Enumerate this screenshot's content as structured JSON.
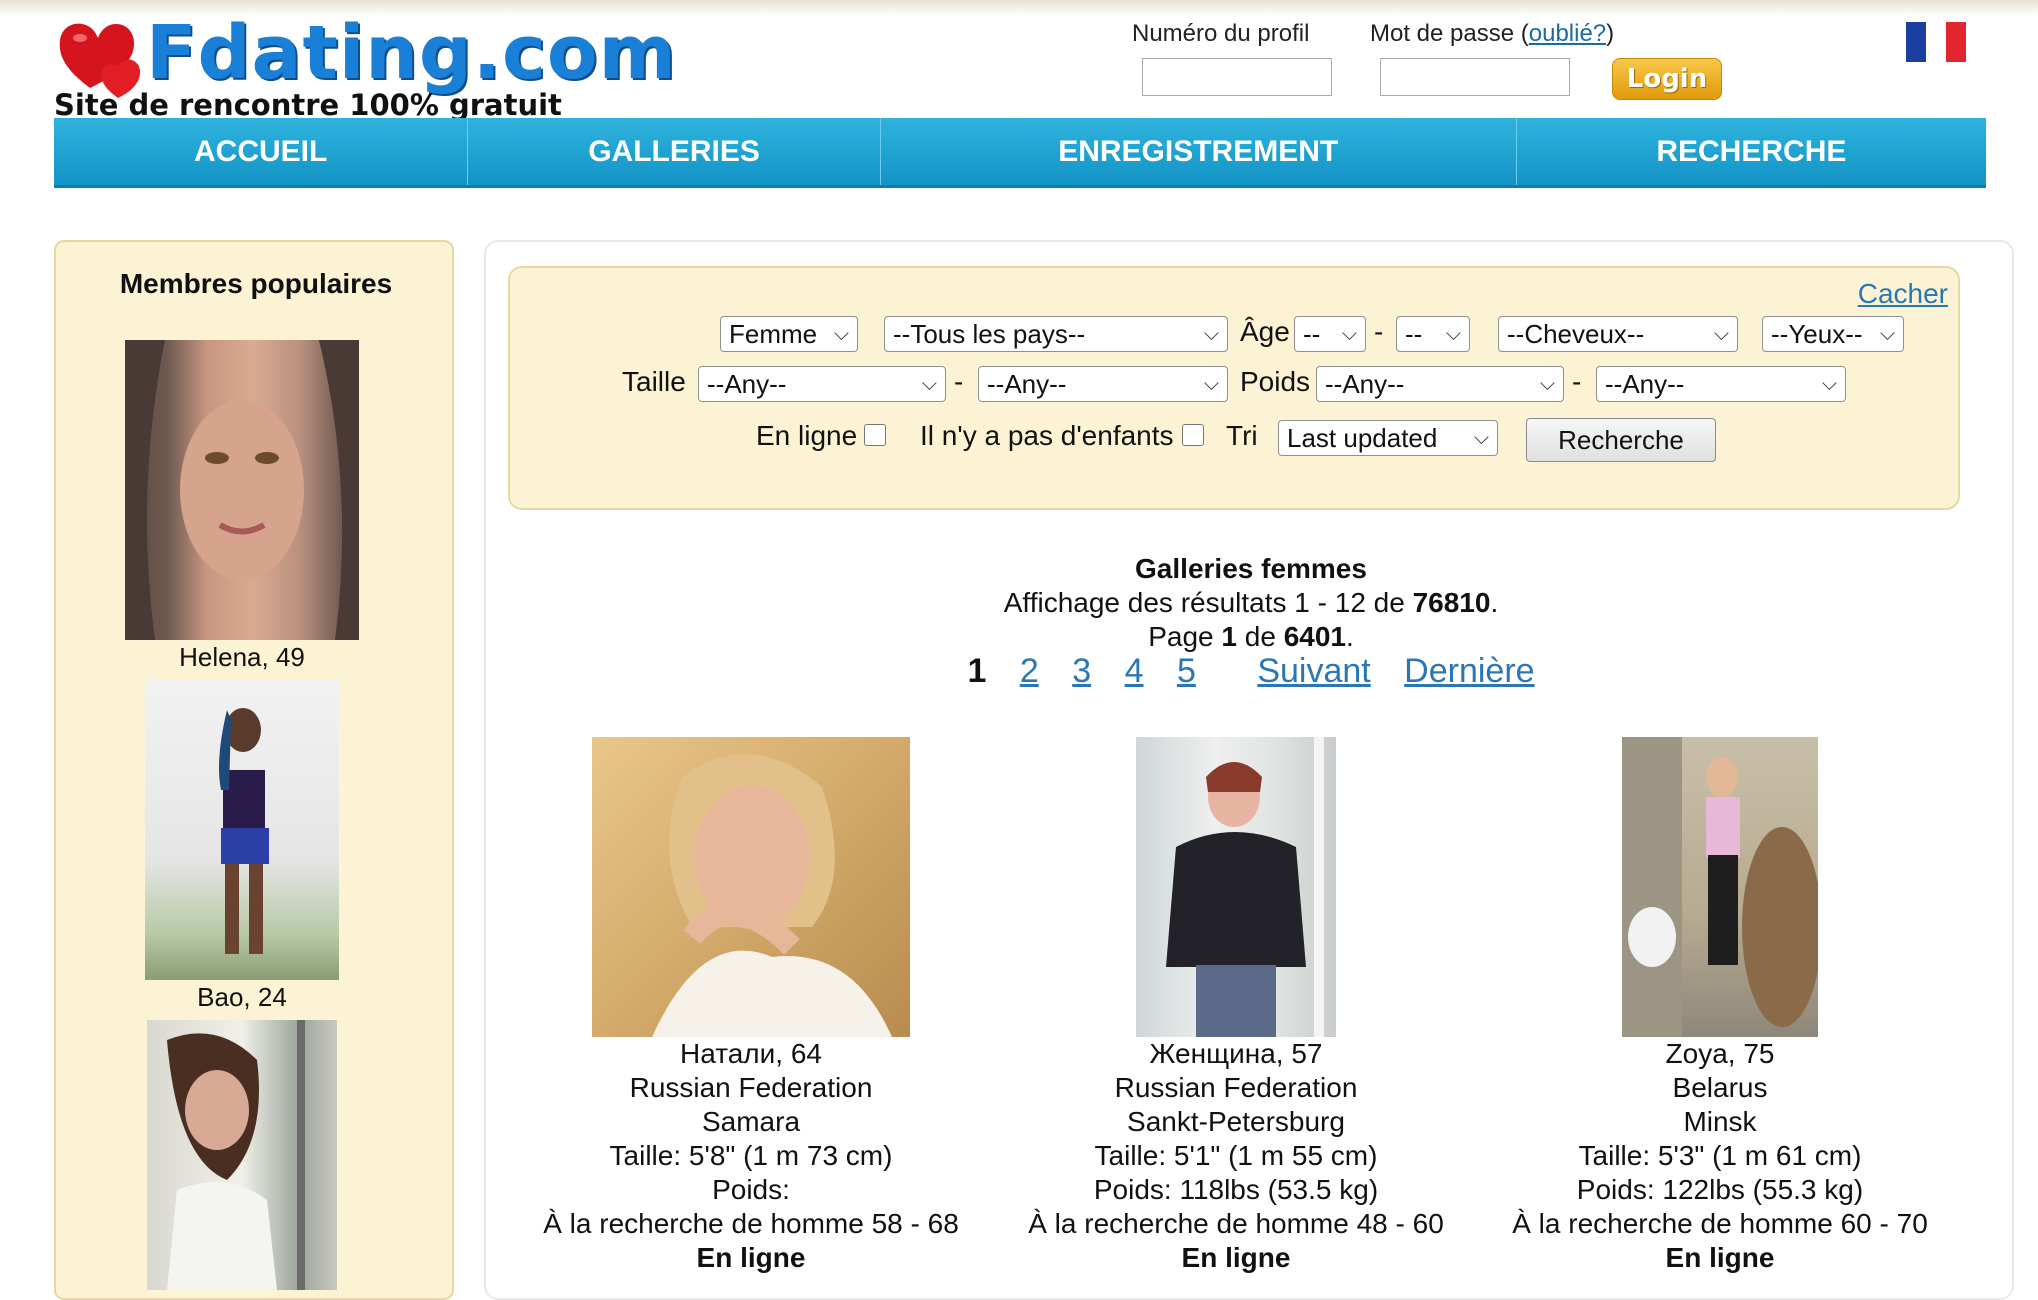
{
  "header": {
    "brand": "Fdating.com",
    "tagline": "Site de rencontre 100% gratuit",
    "login": {
      "profile_label": "Numéro du profil",
      "password_label": "Mot de passe (",
      "forgot_link": "oublié?",
      "password_label_end": ")",
      "login_button": "Login"
    },
    "flag_colors": [
      "#1b3fa0",
      "#ffffff",
      "#e3262e"
    ]
  },
  "nav": {
    "items": [
      {
        "label": "ACCUEIL"
      },
      {
        "label": "GALLERIES"
      },
      {
        "label": "ENREGISTREMENT"
      },
      {
        "label": "RECHERCHE"
      }
    ]
  },
  "sidebar": {
    "title": "Membres populaires",
    "members": [
      {
        "name": "Helena, 49"
      },
      {
        "name": "Bao, 24"
      },
      {
        "name": ""
      }
    ]
  },
  "search": {
    "hide_link": "Cacher",
    "gender": "Femme",
    "country": "--Tous les pays--",
    "age_label": "Âge",
    "age_from": "--",
    "age_to": "--",
    "hair": "--Cheveux--",
    "eyes": "--Yeux--",
    "height_label": "Taille",
    "height_from": "--Any--",
    "height_to": "--Any--",
    "weight_label": "Poids",
    "weight_from": "--Any--",
    "weight_to": "--Any--",
    "online_label": "En ligne",
    "no_children_label": "Il n'y a pas d'enfants",
    "sort_label": "Tri",
    "sort_value": "Last updated",
    "search_button": "Recherche",
    "dash": "-"
  },
  "results": {
    "title": "Galleries femmes",
    "showing_prefix": "Affichage des résultats 1 - 12 de ",
    "total": "76810",
    "page_prefix": "Page ",
    "page_current": "1",
    "page_of": " de ",
    "page_total": "6401",
    "pages": [
      "1",
      "2",
      "3",
      "4",
      "5"
    ],
    "next": "Suivant",
    "last": "Dernière"
  },
  "cards": [
    {
      "name": "Натали, 64",
      "country": "Russian Federation",
      "city": "Samara",
      "height": "Taille: 5'8\" (1 m 73 cm)",
      "weight": "Poids:",
      "seeking": "À la recherche de homme 58 - 68",
      "status": "En ligne"
    },
    {
      "name": "Женщина, 57",
      "country": "Russian Federation",
      "city": "Sankt-Petersburg",
      "height": "Taille: 5'1\" (1 m 55 cm)",
      "weight": "Poids: 118lbs (53.5 kg)",
      "seeking": "À la recherche de homme 48 - 60",
      "status": "En ligne"
    },
    {
      "name": "Zoya, 75",
      "country": "Belarus",
      "city": "Minsk",
      "height": "Taille: 5'3\" (1 m 61 cm)",
      "weight": "Poids: 122lbs (55.3 kg)",
      "seeking": "À la recherche de homme 60 - 70",
      "status": "En ligne"
    }
  ]
}
